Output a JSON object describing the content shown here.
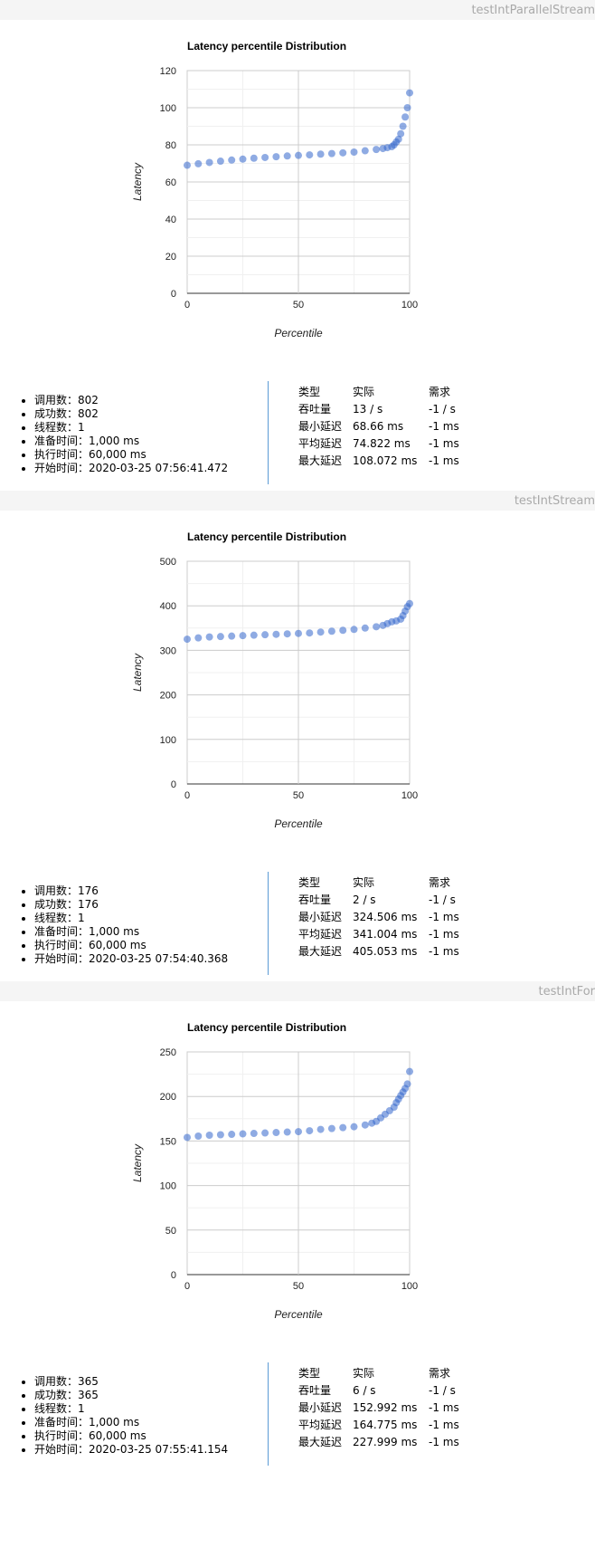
{
  "sections": [
    {
      "title": "testIntParallelStream",
      "stats": [
        "调用数：802",
        "成功数：802",
        "线程数：1",
        "准备时间：1,000 ms",
        "执行时间：60,000 ms",
        "开始时间：2020-03-25 07:56:41.472"
      ],
      "table": {
        "headers": [
          "类型",
          "实际",
          "需求"
        ],
        "rows": [
          [
            "吞吐量",
            "13 / s",
            "-1 / s"
          ],
          [
            "最小延迟",
            "68.66 ms",
            "-1 ms"
          ],
          [
            "平均延迟",
            "74.822 ms",
            "-1 ms"
          ],
          [
            "最大延迟",
            "108.072 ms",
            "-1 ms"
          ]
        ]
      }
    },
    {
      "title": "testIntStream",
      "stats": [
        "调用数：176",
        "成功数：176",
        "线程数：1",
        "准备时间：1,000 ms",
        "执行时间：60,000 ms",
        "开始时间：2020-03-25 07:54:40.368"
      ],
      "table": {
        "headers": [
          "类型",
          "实际",
          "需求"
        ],
        "rows": [
          [
            "吞吐量",
            "2 / s",
            "-1 / s"
          ],
          [
            "最小延迟",
            "324.506 ms",
            "-1 ms"
          ],
          [
            "平均延迟",
            "341.004 ms",
            "-1 ms"
          ],
          [
            "最大延迟",
            "405.053 ms",
            "-1 ms"
          ]
        ]
      }
    },
    {
      "title": "testIntFor",
      "stats": [
        "调用数：365",
        "成功数：365",
        "线程数：1",
        "准备时间：1,000 ms",
        "执行时间：60,000 ms",
        "开始时间：2020-03-25 07:55:41.154"
      ],
      "table": {
        "headers": [
          "类型",
          "实际",
          "需求"
        ],
        "rows": [
          [
            "吞吐量",
            "6 / s",
            "-1 / s"
          ],
          [
            "最小延迟",
            "152.992 ms",
            "-1 ms"
          ],
          [
            "平均延迟",
            "164.775 ms",
            "-1 ms"
          ],
          [
            "最大延迟",
            "227.999 ms",
            "-1 ms"
          ]
        ]
      }
    }
  ],
  "chart_data": [
    {
      "type": "scatter",
      "title": "Latency percentile Distribution",
      "xlabel": "Percentile",
      "ylabel": "Latency",
      "xlim": [
        0,
        100
      ],
      "ylim": [
        0,
        120
      ],
      "xticks": [
        0,
        50,
        100
      ],
      "yticks": [
        0,
        20,
        40,
        60,
        80,
        100,
        120
      ],
      "grid": true,
      "color": "#3366cc",
      "x": [
        0,
        5,
        10,
        15,
        20,
        25,
        30,
        35,
        40,
        45,
        50,
        55,
        60,
        65,
        70,
        75,
        80,
        85,
        88,
        90,
        92,
        93,
        94,
        95,
        96,
        97,
        98,
        99,
        100
      ],
      "y": [
        69,
        69.8,
        70.5,
        71.2,
        71.8,
        72.3,
        72.8,
        73.2,
        73.6,
        74,
        74.3,
        74.6,
        75,
        75.3,
        75.7,
        76.1,
        76.8,
        77.5,
        78,
        78.5,
        79,
        80,
        81.5,
        83,
        86,
        90,
        95,
        100,
        108
      ]
    },
    {
      "type": "scatter",
      "title": "Latency percentile Distribution",
      "xlabel": "Percentile",
      "ylabel": "Latency",
      "xlim": [
        0,
        100
      ],
      "ylim": [
        0,
        500
      ],
      "xticks": [
        0,
        50,
        100
      ],
      "yticks": [
        0,
        100,
        200,
        300,
        400,
        500
      ],
      "grid": true,
      "color": "#3366cc",
      "x": [
        0,
        5,
        10,
        15,
        20,
        25,
        30,
        35,
        40,
        45,
        50,
        55,
        60,
        65,
        70,
        75,
        80,
        85,
        88,
        90,
        92,
        94,
        96,
        97,
        98,
        99,
        100
      ],
      "y": [
        325,
        328,
        330,
        331,
        332,
        333,
        334,
        335,
        336,
        337,
        338,
        339,
        341,
        343,
        345,
        347,
        350,
        353,
        356,
        360,
        364,
        366,
        370,
        378,
        388,
        398,
        405
      ]
    },
    {
      "type": "scatter",
      "title": "Latency percentile Distribution",
      "xlabel": "Percentile",
      "ylabel": "Latency",
      "xlim": [
        0,
        100
      ],
      "ylim": [
        0,
        250
      ],
      "xticks": [
        0,
        50,
        100
      ],
      "yticks": [
        0,
        50,
        100,
        150,
        200,
        250
      ],
      "grid": true,
      "color": "#3366cc",
      "x": [
        0,
        5,
        10,
        15,
        20,
        25,
        30,
        35,
        40,
        45,
        50,
        55,
        60,
        65,
        70,
        75,
        80,
        83,
        85,
        87,
        89,
        91,
        93,
        94,
        95,
        96,
        97,
        98,
        99,
        100
      ],
      "y": [
        154,
        155.5,
        156.5,
        157,
        157.5,
        158,
        158.5,
        159,
        159.5,
        160,
        160.5,
        161.5,
        163,
        164,
        165,
        166,
        168,
        170,
        172,
        176,
        180,
        184,
        188,
        193,
        197,
        201,
        205,
        209,
        214,
        228
      ]
    }
  ]
}
